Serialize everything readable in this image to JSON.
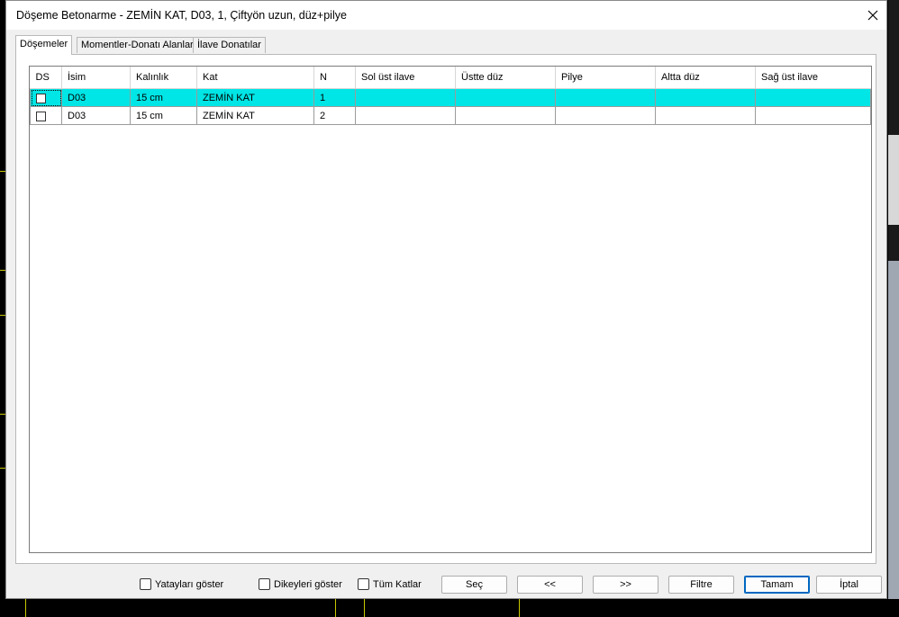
{
  "window": {
    "title": "Döşeme Betonarme - ZEMİN KAT, D03, 1, Çiftyön uzun, düz+pilye"
  },
  "tabs": [
    {
      "label": "Döşemeler",
      "active": true
    },
    {
      "label": "Momentler-Donatı Alanları",
      "active": false
    },
    {
      "label": "İlave Donatılar",
      "active": false
    }
  ],
  "table": {
    "columns": [
      "DS",
      "İsim",
      "Kalınlık",
      "Kat",
      "N",
      "Sol üst ilave",
      "Üstte düz",
      "Pilye",
      "Altta düz",
      "Sağ üst ilave"
    ],
    "rows": [
      {
        "checked": false,
        "isim": "D03",
        "kalinlik": "15 cm",
        "kat": "ZEMİN KAT",
        "n": "1",
        "sol_ust_ilave": "",
        "ustte_duz": "",
        "pilye": "",
        "altta_duz": "",
        "sag_ust_ilave": "",
        "selected": true
      },
      {
        "checked": false,
        "isim": "D03",
        "kalinlik": "15 cm",
        "kat": "ZEMİN KAT",
        "n": "2",
        "sol_ust_ilave": "",
        "ustte_duz": "",
        "pilye": "",
        "altta_duz": "",
        "sag_ust_ilave": "",
        "selected": false
      }
    ]
  },
  "options": {
    "yataylari_goster": "Yatayları göster",
    "dikeyleri_goster": "Dikeyleri göster",
    "tum_katlar": "Tüm Katlar"
  },
  "buttons": {
    "sec": "Seç",
    "prev": "<<",
    "next": ">>",
    "filtre": "Filtre",
    "tamam": "Tamam",
    "iptal": "İptal"
  },
  "colors": {
    "selection": "#00e5e5",
    "default_button_border": "#0067c0"
  }
}
